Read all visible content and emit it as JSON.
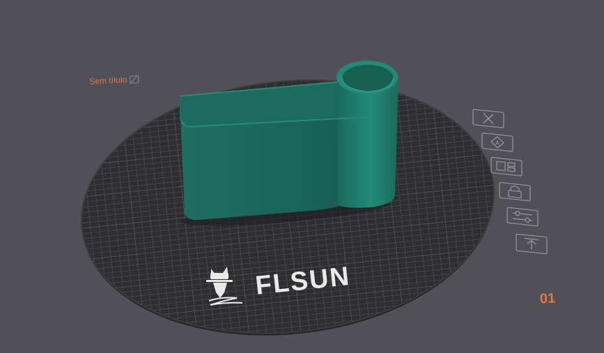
{
  "plate": {
    "name_label": "Sem título",
    "number": "01"
  },
  "bed": {
    "brand": "FLSUN"
  },
  "plate_toolbar": [
    {
      "name": "remove-plate",
      "icon": "close-icon"
    },
    {
      "name": "auto-orient",
      "icon": "auto-orient-icon"
    },
    {
      "name": "arrange",
      "icon": "arrange-icon"
    },
    {
      "name": "lock-plate",
      "icon": "lock-icon"
    },
    {
      "name": "plate-settings",
      "icon": "sliders-icon"
    },
    {
      "name": "move-to-top",
      "icon": "arrow-up-icon"
    }
  ],
  "colors": {
    "background": "#505056",
    "bed": "#2e2e31",
    "grid": "#4a4a50",
    "model": "#1e6e60",
    "accent": "#e8744a"
  }
}
